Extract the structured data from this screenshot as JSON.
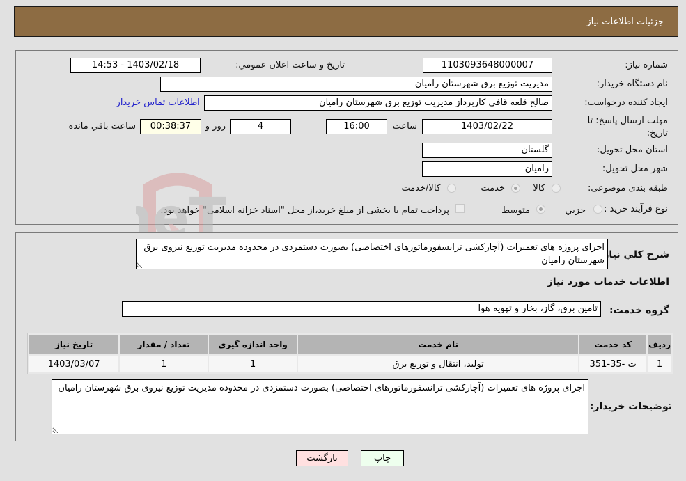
{
  "header": {
    "title": "جزئیات اطلاعات نیاز"
  },
  "form": {
    "need_number": {
      "label": "شماره نیاز:",
      "value": "1103093648000007"
    },
    "announce_datetime": {
      "label": "تاریخ و ساعت اعلان عمومي:",
      "value": "1403/02/18 - 14:53"
    },
    "buyer_org": {
      "label": "نام دستگاه خريدار:",
      "value": "مديريت توزيع برق شهرستان راميان"
    },
    "requester": {
      "label": "ایجاد کننده درخواست:",
      "value": "صالح قلعه قافی کاربرداز مدیریت توزیع برق شهرستان رامیان"
    },
    "contact_link": "اطلاعات تماس خریدار",
    "deadline": {
      "label": "مهلت ارسال پاسخ: تا تاریخ:",
      "date": "1403/02/22",
      "time_label": "ساعت",
      "time": "16:00",
      "days": "4",
      "days_label": "روز و",
      "remaining": "00:38:37",
      "remaining_label": "ساعت باقي مانده"
    },
    "province": {
      "label": "استان محل تحویل:",
      "value": "گلستان"
    },
    "city": {
      "label": "شهر محل تحویل:",
      "value": "رامیان"
    },
    "category": {
      "label": "طبقه بندی موضوعی:",
      "options": [
        {
          "label": "کالا",
          "checked": false
        },
        {
          "label": "خدمت",
          "checked": true
        },
        {
          "label": "کالا/خدمت",
          "checked": false
        }
      ]
    },
    "purchase_type": {
      "label": "نوع فرآیند خرید :",
      "options": [
        {
          "label": "جزيي",
          "checked": false
        },
        {
          "label": "متوسط",
          "checked": true
        }
      ],
      "treasury_checkbox_label": "پرداخت تمام یا بخشی از مبلغ خرید،از محل \"اسناد خزانه اسلامی\" خواهد بود.",
      "treasury_checked": false
    }
  },
  "details": {
    "general_desc_label": "شرح کلي نياز:",
    "general_desc": "اجرای پروژه های تعمیرات (آچارکشی ترانسفورماتورهای اختصاصی) بصورت دستمزدی در محدوده مدیریت توزیع نیروی برق شهرستان رامیان",
    "services_title": "اطلاعات خدمات مورد نياز",
    "service_group_label": "گروه خدمت:",
    "service_group": "تامین برق، گاز، بخار و تهویه هوا",
    "table": {
      "headers": [
        "ردیف",
        "کد خدمت",
        "نام خدمت",
        "واحد اندازه گیری",
        "تعداد / مقدار",
        "تاریخ نیاز"
      ],
      "rows": [
        [
          "1",
          "ت -35-351",
          "تولید، انتقال و توزیع برق",
          "1",
          "1",
          "1403/03/07"
        ]
      ]
    },
    "buyer_notes_label": "توضیحات خریدار:",
    "buyer_notes": "اجرای پروژه های تعمیرات (آچارکشی ترانسفورماتورهای اختصاصی) بصورت دستمزدی در محدوده مدیریت توزیع نیروی برق شهرستان رامیان"
  },
  "buttons": {
    "print": "چاپ",
    "back": "بازگشت"
  },
  "watermark": {
    "text": "AriaTender.neT"
  },
  "colors": {
    "header_bg": "#8d6c43",
    "print_bg": "#eeffee",
    "back_bg": "#ffe0e0",
    "link": "#2222cc"
  }
}
